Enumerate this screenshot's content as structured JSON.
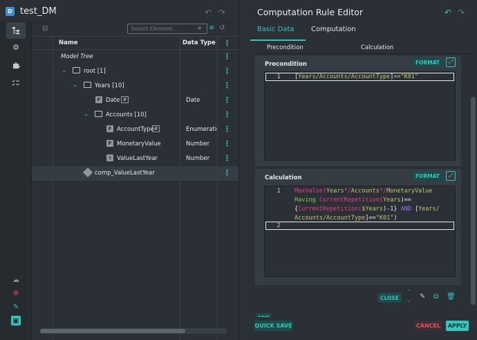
{
  "app": {
    "logo_letter": "D",
    "title": "test_DM"
  },
  "search": {
    "placeholder": "Search Elements..."
  },
  "tree": {
    "col_name": "Name",
    "col_type": "Data Type",
    "rows": [
      {
        "label": "Model Tree",
        "type": ""
      },
      {
        "label": "root [1]",
        "type": ""
      },
      {
        "label": "Years [10]",
        "type": ""
      },
      {
        "label": "Date",
        "type": "Date",
        "badge": "F",
        "tag": "#"
      },
      {
        "label": "Accounts [10]",
        "type": ""
      },
      {
        "label": "AccountType",
        "type": "Enumeration",
        "badge": "F",
        "tag": "#"
      },
      {
        "label": "MonetaryValue",
        "type": "Number",
        "badge": "F"
      },
      {
        "label": "ValueLastYear",
        "type": "Number"
      },
      {
        "label": "comp_ValueLastYear",
        "type": ""
      }
    ]
  },
  "editor": {
    "title": "Computation Rule Editor",
    "tabs": [
      "Basic Data",
      "Computation"
    ],
    "subheader": {
      "precondition": "Precondition",
      "calculation": "Calculation"
    },
    "precondition": {
      "label": "Precondition",
      "format_label": "FORMAT",
      "line_number": "1",
      "code": {
        "bracket_open": "[",
        "path": "Years/Accounts/AccountType",
        "bracket_close": "]",
        "op": "==",
        "str": "\"K01\""
      }
    },
    "calculation": {
      "label": "Calculation",
      "format_label": "FORMAT",
      "line_numbers": [
        "1",
        "2"
      ],
      "code": {
        "l1_fn": "MaxValue(",
        "l1_p1": "Years",
        "l1_s1": "*/",
        "l1_p2": "Accounts",
        "l1_s2": "*/",
        "l1_p3": "MonetaryValue",
        "l2_kw": "Having",
        "l2_fn": "CurrentRepetition(",
        "l2_p": "Years",
        "l2_end": ")==",
        "l3_open": "{",
        "l3_fn": "CurrentRepetition(",
        "l3_var": "$Years",
        "l3_mid": ")-1}",
        "l3_and": "AND",
        "l3_br": "[",
        "l3_p": "Years/",
        "l4_p": "Accounts/AccountType",
        "l4_op": "]==",
        "l4_str": "\"K01\"",
        "l4_close": ")"
      }
    },
    "close_label": "CLOSE",
    "add_label": "ADD",
    "quick_save_label": "QUICK SAVE",
    "cancel_label": "CANCEL",
    "apply_label": "APPLY"
  }
}
